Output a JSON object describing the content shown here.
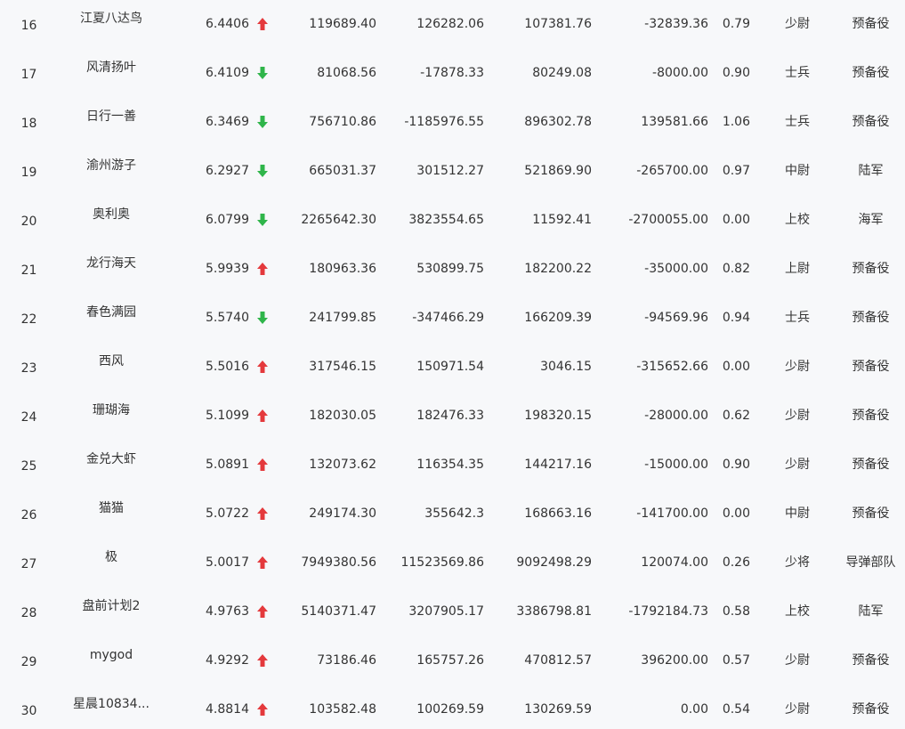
{
  "colors": {
    "up": "#e4393c",
    "down": "#2fb54a",
    "text": "#333333",
    "background": "#f7f8fa"
  },
  "rows": [
    {
      "rank": "16",
      "name": "江夏八达鸟",
      "score": "6.4406",
      "trend": "up",
      "v1": "119689.40",
      "v2": "126282.06",
      "v3": "107381.76",
      "v4": "-32839.36",
      "ratio": "0.79",
      "rank_title": "少尉",
      "unit": "预备役"
    },
    {
      "rank": "17",
      "name": "风清扬叶",
      "score": "6.4109",
      "trend": "down",
      "v1": "81068.56",
      "v2": "-17878.33",
      "v3": "80249.08",
      "v4": "-8000.00",
      "ratio": "0.90",
      "rank_title": "士兵",
      "unit": "预备役"
    },
    {
      "rank": "18",
      "name": "日行一善",
      "score": "6.3469",
      "trend": "down",
      "v1": "756710.86",
      "v2": "-1185976.55",
      "v3": "896302.78",
      "v4": "139581.66",
      "ratio": "1.06",
      "rank_title": "士兵",
      "unit": "预备役"
    },
    {
      "rank": "19",
      "name": "渝州游子",
      "score": "6.2927",
      "trend": "down",
      "v1": "665031.37",
      "v2": "301512.27",
      "v3": "521869.90",
      "v4": "-265700.00",
      "ratio": "0.97",
      "rank_title": "中尉",
      "unit": "陆军"
    },
    {
      "rank": "20",
      "name": "奥利奥",
      "score": "6.0799",
      "trend": "down",
      "v1": "2265642.30",
      "v2": "3823554.65",
      "v3": "11592.41",
      "v4": "-2700055.00",
      "ratio": "0.00",
      "rank_title": "上校",
      "unit": "海军"
    },
    {
      "rank": "21",
      "name": "龙行海天",
      "score": "5.9939",
      "trend": "up",
      "v1": "180963.36",
      "v2": "530899.75",
      "v3": "182200.22",
      "v4": "-35000.00",
      "ratio": "0.82",
      "rank_title": "上尉",
      "unit": "预备役"
    },
    {
      "rank": "22",
      "name": "春色满园",
      "score": "5.5740",
      "trend": "down",
      "v1": "241799.85",
      "v2": "-347466.29",
      "v3": "166209.39",
      "v4": "-94569.96",
      "ratio": "0.94",
      "rank_title": "士兵",
      "unit": "预备役"
    },
    {
      "rank": "23",
      "name": "西风",
      "score": "5.5016",
      "trend": "up",
      "v1": "317546.15",
      "v2": "150971.54",
      "v3": "3046.15",
      "v4": "-315652.66",
      "ratio": "0.00",
      "rank_title": "少尉",
      "unit": "预备役"
    },
    {
      "rank": "24",
      "name": "珊瑚海",
      "score": "5.1099",
      "trend": "up",
      "v1": "182030.05",
      "v2": "182476.33",
      "v3": "198320.15",
      "v4": "-28000.00",
      "ratio": "0.62",
      "rank_title": "少尉",
      "unit": "预备役"
    },
    {
      "rank": "25",
      "name": "金兑大虾",
      "score": "5.0891",
      "trend": "up",
      "v1": "132073.62",
      "v2": "116354.35",
      "v3": "144217.16",
      "v4": "-15000.00",
      "ratio": "0.90",
      "rank_title": "少尉",
      "unit": "预备役"
    },
    {
      "rank": "26",
      "name": "猫猫",
      "score": "5.0722",
      "trend": "up",
      "v1": "249174.30",
      "v2": "355642.3",
      "v3": "168663.16",
      "v4": "-141700.00",
      "ratio": "0.00",
      "rank_title": "中尉",
      "unit": "预备役"
    },
    {
      "rank": "27",
      "name": "极",
      "score": "5.0017",
      "trend": "up",
      "v1": "7949380.56",
      "v2": "11523569.86",
      "v3": "9092498.29",
      "v4": "120074.00",
      "ratio": "0.26",
      "rank_title": "少将",
      "unit": "导弹部队"
    },
    {
      "rank": "28",
      "name": "盘前计划2",
      "score": "4.9763",
      "trend": "up",
      "v1": "5140371.47",
      "v2": "3207905.17",
      "v3": "3386798.81",
      "v4": "-1792184.73",
      "ratio": "0.58",
      "rank_title": "上校",
      "unit": "陆军"
    },
    {
      "rank": "29",
      "name": "mygod",
      "score": "4.9292",
      "trend": "up",
      "v1": "73186.46",
      "v2": "165757.26",
      "v3": "470812.57",
      "v4": "396200.00",
      "ratio": "0.57",
      "rank_title": "少尉",
      "unit": "预备役"
    },
    {
      "rank": "30",
      "name": "星晨10834...",
      "score": "4.8814",
      "trend": "up",
      "v1": "103582.48",
      "v2": "100269.59",
      "v3": "130269.59",
      "v4": "0.00",
      "ratio": "0.54",
      "rank_title": "少尉",
      "unit": "预备役"
    }
  ]
}
